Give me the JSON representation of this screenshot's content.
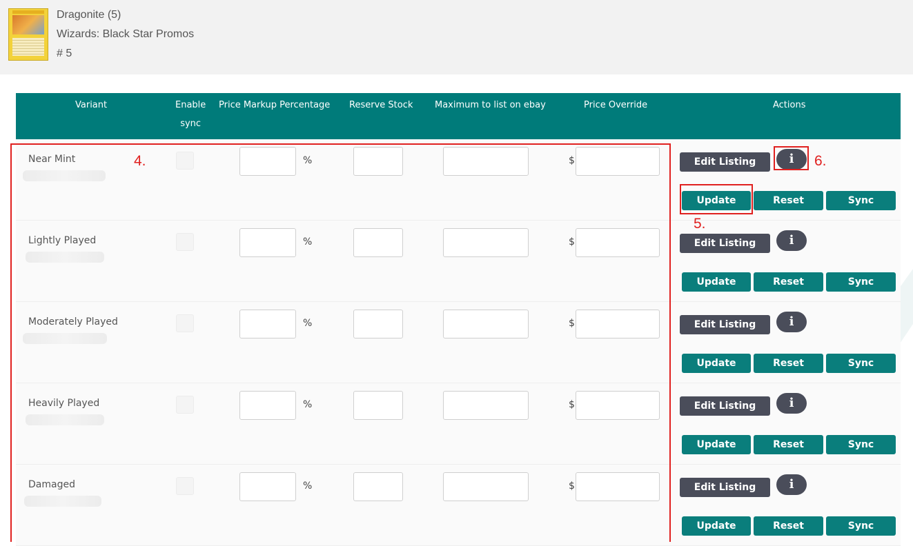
{
  "header": {
    "card_name": "Dragonite (5)",
    "set_name": "Wizards: Black Star Promos",
    "card_number": "# 5"
  },
  "table": {
    "columns": {
      "variant": "Variant",
      "enable_sync_line1": "Enable",
      "enable_sync_line2": "sync",
      "markup": "Price Markup Percentage",
      "reserve": "Reserve Stock",
      "maximum": "Maximum to list on ebay",
      "override": "Price Override",
      "actions": "Actions"
    },
    "percent_symbol": "%",
    "currency_symbol": "$",
    "rows": [
      {
        "variant": "Near Mint"
      },
      {
        "variant": "Lightly Played"
      },
      {
        "variant": "Moderately Played"
      },
      {
        "variant": "Heavily Played"
      },
      {
        "variant": "Damaged"
      }
    ]
  },
  "actions": {
    "edit_listing": "Edit Listing",
    "update": "Update",
    "reset": "Reset",
    "sync": "Sync",
    "info": "i"
  },
  "annotations": {
    "label_4": "4.",
    "label_5": "5.",
    "label_6": "6."
  },
  "colors": {
    "header_teal": "#007b7a",
    "button_teal": "#0a7e7c",
    "button_dark": "#4a4d5a",
    "annotation_red": "#e0201f"
  }
}
